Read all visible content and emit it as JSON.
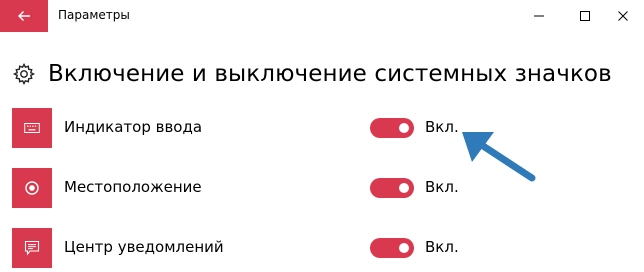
{
  "window": {
    "title": "Параметры"
  },
  "page": {
    "title": "Включение и выключение системных значков"
  },
  "items": [
    {
      "label": "Индикатор ввода",
      "state": "Вкл.",
      "on": true,
      "icon": "keyboard-icon"
    },
    {
      "label": "Местоположение",
      "state": "Вкл.",
      "on": true,
      "icon": "location-icon"
    },
    {
      "label": "Центр уведомлений",
      "state": "Вкл.",
      "on": true,
      "icon": "notification-icon"
    }
  ],
  "colors": {
    "accent": "#d8394e",
    "annotation_arrow": "#2f7ab8"
  }
}
